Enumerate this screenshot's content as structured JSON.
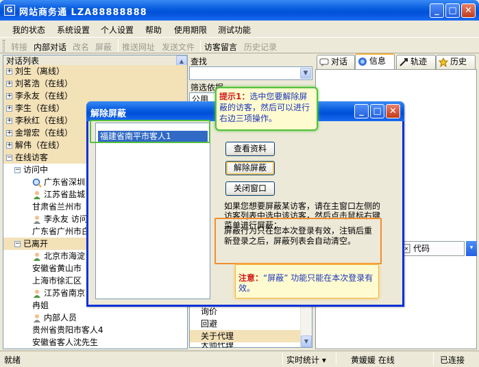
{
  "window": {
    "title": "网站商务通  LZA88888888",
    "icon_text": "G",
    "minimize": "_",
    "maximize": "□",
    "close": "✕"
  },
  "menu": [
    "我的状态",
    "系统设置",
    "个人设置",
    "帮助",
    "使用期限",
    "测试功能"
  ],
  "toolbar": {
    "items": [
      {
        "label": "转接",
        "enabled": false
      },
      {
        "label": "内部对话",
        "enabled": true
      },
      {
        "label": "改名",
        "enabled": false
      },
      {
        "label": "屏蔽",
        "enabled": false
      },
      {
        "label": "推送网址",
        "enabled": false
      },
      {
        "label": "发送文件",
        "enabled": false
      },
      {
        "label": "访客留言",
        "enabled": true
      },
      {
        "label": "历史记录",
        "enabled": false
      }
    ]
  },
  "left_panel": {
    "header": "对话列表",
    "rows": [
      {
        "text": "刘生（离线）",
        "pm": "+",
        "highlight": true
      },
      {
        "text": "刘茗浩（在线）",
        "pm": "+",
        "highlight": true
      },
      {
        "text": "李永友（在线）",
        "pm": "+",
        "highlight": true
      },
      {
        "text": "李生（在线）",
        "pm": "+",
        "highlight": true
      },
      {
        "text": "李秋红（在线）",
        "pm": "+",
        "highlight": true
      },
      {
        "text": "金增宏（在线）",
        "pm": "+",
        "highlight": true
      },
      {
        "text": "解伟（在线）",
        "pm": "+",
        "highlight": true
      },
      {
        "text": "在线访客",
        "pm": "−",
        "highlight": true
      },
      {
        "text": "访问中",
        "pm": "−",
        "highlight": false
      },
      {
        "text": "广东省深圳",
        "icon": "search",
        "highlight": false
      },
      {
        "text": "江苏省盐城",
        "icon": "person",
        "highlight": false
      },
      {
        "text": "甘肃省兰州市",
        "highlight": false
      },
      {
        "text": "李永友 访问",
        "icon": "person",
        "highlight": false
      },
      {
        "text": "广东省广州市白",
        "highlight": false
      },
      {
        "text": "已离开",
        "pm": "−",
        "highlight": true
      },
      {
        "text": "北京市海淀",
        "icon": "person",
        "highlight": false
      },
      {
        "text": "安徽省黄山市",
        "highlight": false
      },
      {
        "text": "上海市徐汇区",
        "highlight": false
      },
      {
        "text": "江苏省南京",
        "icon": "person",
        "highlight": false
      },
      {
        "text": "冉姐",
        "highlight": false
      },
      {
        "text": "内部人员",
        "icon": "person",
        "highlight": false
      },
      {
        "text": "贵州省贵阳市客人4",
        "highlight": false
      },
      {
        "text": "安徽省客人沈先生",
        "highlight": false
      }
    ]
  },
  "mid_panel": {
    "search_label": "查找",
    "filter_label": "筛选依据",
    "filter_first": "公用",
    "bottom_rows": [
      {
        "text": "询价",
        "highlight": false
      },
      {
        "text": "回避",
        "highlight": false
      },
      {
        "text": "关于代理",
        "highlight": true
      },
      {
        "text": "大师代理",
        "highlight": false
      }
    ]
  },
  "right_panel": {
    "tabs": [
      {
        "label": "对话",
        "icon": "chat-icon",
        "active": false
      },
      {
        "label": "信息",
        "icon": "info-icon",
        "active": true
      },
      {
        "label": "轨迹",
        "icon": "track-icon",
        "active": false
      },
      {
        "label": "历史",
        "icon": "history-icon",
        "active": false
      }
    ],
    "code_tab": "代码"
  },
  "statusbar": {
    "left": "就绪",
    "stats": "实时统计 ▾",
    "user": "黄媛媛 在线",
    "conn": "已连接"
  },
  "dialog": {
    "title": "解除屏蔽",
    "list_items": [
      "福建省南平市客人1"
    ],
    "btn_view": "查看资料",
    "btn_unblock": "解除屏蔽",
    "btn_close": "关闭窗口",
    "note": "如果您想要屏蔽某访客，请在主窗口左侧的访客列表中选中该访客，然后点击鼠标右键菜单进行屏蔽；",
    "scope": "屏蔽行为只在您本次登录有效，注销后重新登录之后，屏蔽列表会自动清空。",
    "warn_key": "注意：",
    "warn_text": "“屏蔽” 功能只能在本次登录有效。"
  },
  "hint": {
    "key": "提示1：",
    "text": "选中您要解除屏蔽的访客，然后可以进行右边三项操作。"
  },
  "colors": {
    "titlebar": "#0a5fe0",
    "highlight_row": "#f3e1b8",
    "selection": "#316ac5",
    "green_annotation": "#54c13c",
    "orange_annotation": "#f18d2c"
  }
}
